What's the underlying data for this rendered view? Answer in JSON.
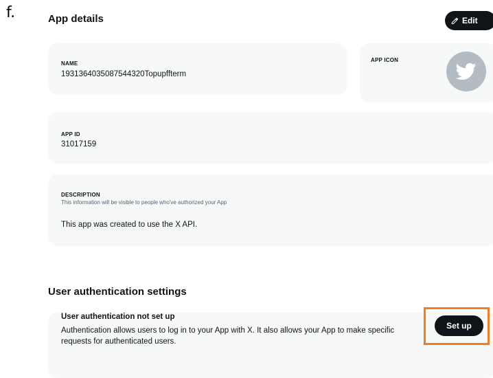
{
  "step_label": "f.",
  "app_details": {
    "title": "App details",
    "edit_label": "Edit",
    "name_label": "NAME",
    "name_value": "1931364035087544320Topupffterm",
    "icon_label": "APP ICON",
    "app_id_label": "APP ID",
    "app_id_value": "31017159",
    "description_label": "DESCRIPTION",
    "description_hint": "This information will be visible to people who've authorized your App",
    "description_value": "This app was created to use the X API."
  },
  "user_auth": {
    "title": "User authentication settings",
    "status_heading": "User authentication not set up",
    "status_desc": "Authentication allows users to log in to your App with X. It also allows your App to make specific requests for authenticated users.",
    "setup_label": "Set up"
  },
  "colors": {
    "highlight": "#f47b20",
    "button_bg": "#0f1419",
    "card_bg": "#f7f8f8",
    "avatar_bg": "#b3bcc2"
  },
  "icons": {
    "edit": "pencil-icon",
    "app_icon": "bird-icon"
  }
}
